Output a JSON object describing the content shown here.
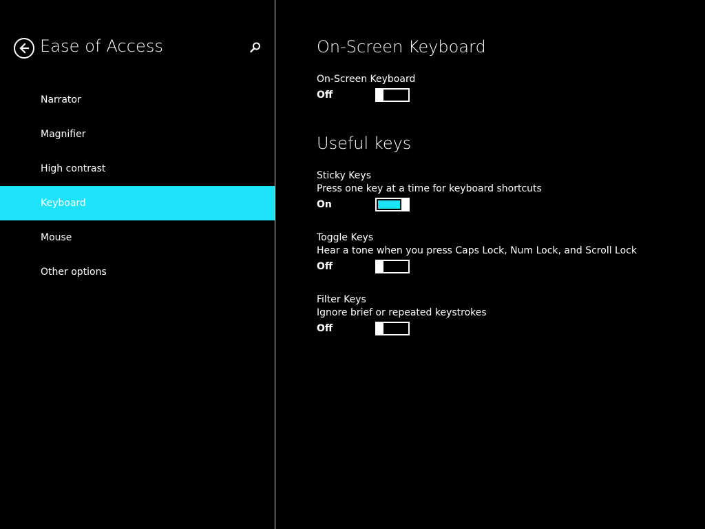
{
  "colors": {
    "accent": "#1ee3f8",
    "background": "#000000",
    "text": "#ffffff"
  },
  "sidebar": {
    "title": "Ease of Access",
    "back_icon": "back-arrow-circle-icon",
    "search_icon": "search-icon",
    "items": [
      {
        "label": "Narrator",
        "selected": false
      },
      {
        "label": "Magnifier",
        "selected": false
      },
      {
        "label": "High contrast",
        "selected": false
      },
      {
        "label": "Keyboard",
        "selected": true
      },
      {
        "label": "Mouse",
        "selected": false
      },
      {
        "label": "Other options",
        "selected": false
      }
    ]
  },
  "main": {
    "section1": {
      "heading": "On-Screen Keyboard",
      "settings": [
        {
          "label": "On-Screen Keyboard",
          "description": "",
          "state": "Off",
          "on": false
        }
      ]
    },
    "section2": {
      "heading": "Useful keys",
      "settings": [
        {
          "label": "Sticky Keys",
          "description": "Press one key at a time for keyboard shortcuts",
          "state": "On",
          "on": true
        },
        {
          "label": "Toggle Keys",
          "description": "Hear a tone when you press Caps Lock, Num Lock, and Scroll Lock",
          "state": "Off",
          "on": false
        },
        {
          "label": "Filter Keys",
          "description": "Ignore brief or repeated keystrokes",
          "state": "Off",
          "on": false
        }
      ]
    }
  }
}
